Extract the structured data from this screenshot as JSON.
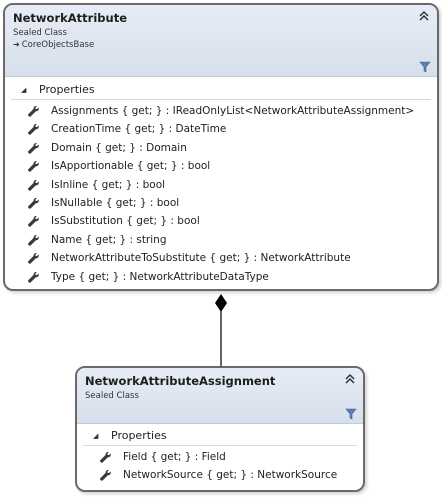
{
  "classes": [
    {
      "name": "NetworkAttribute",
      "kind": "Sealed Class",
      "base": "CoreObjectsBase",
      "section": "Properties",
      "members": [
        "Assignments { get; } : IReadOnlyList<NetworkAttributeAssignment>",
        "CreationTime { get; } : DateTime",
        "Domain { get; } : Domain",
        "IsApportionable { get; } : bool",
        "IsInline { get; } : bool",
        "IsNullable { get; } : bool",
        "IsSubstitution { get; } : bool",
        "Name { get; } : string",
        "NetworkAttributeToSubstitute { get; } : NetworkAttribute",
        "Type { get; } : NetworkAttributeDataType"
      ]
    },
    {
      "name": "NetworkAttributeAssignment",
      "kind": "Sealed Class",
      "section": "Properties",
      "members": [
        "Field { get; } : Field",
        "NetworkSource { get; } : NetworkSource"
      ]
    }
  ],
  "icons": {
    "collapse": "double-chevron-up-icon",
    "filter": "funnel-icon",
    "member": "wrench-icon",
    "base": "inheritance-arrow-icon",
    "section_toggle": "triangle-down-icon"
  },
  "colors": {
    "header_top": "#e7edf6",
    "header_bottom": "#d6dfec",
    "border": "#6a6a6a",
    "filter_icon": "#5b7fb5"
  }
}
